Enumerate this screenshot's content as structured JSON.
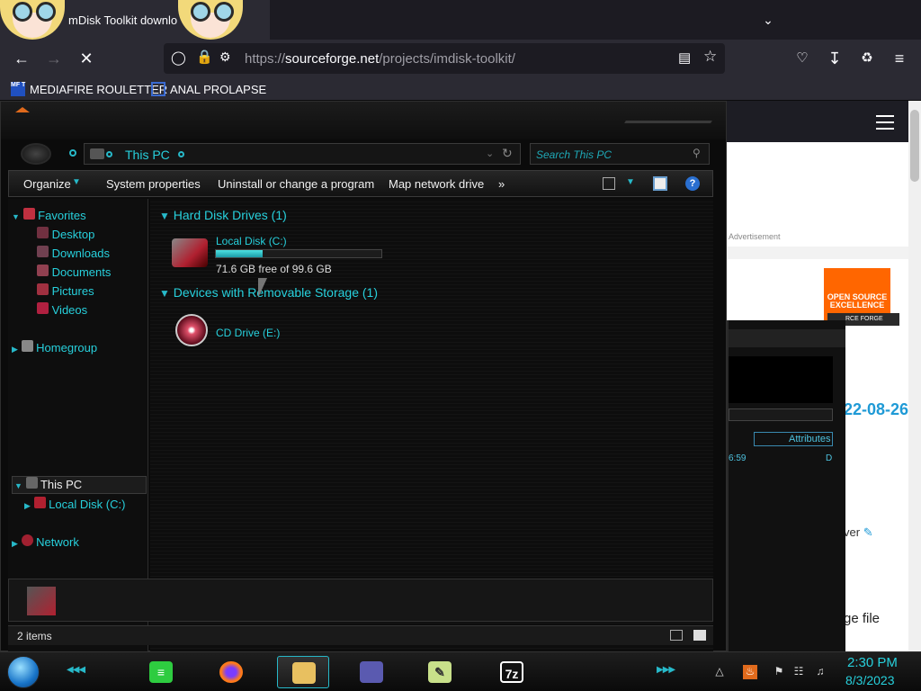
{
  "browser": {
    "tab_title": "mDisk Toolkit downlo",
    "url_prefix": "https://",
    "url_domain": "sourceforge.net",
    "url_path": "/projects/imdisk-toolkit/",
    "bookmarks": [
      {
        "label": "MEDIAFIRE ROULETTER",
        "icon_text": "MF T"
      },
      {
        "label": "ANAL PROLAPSE"
      }
    ]
  },
  "webpage": {
    "advertisement_label": "Advertisement",
    "badge_text": "OPEN SOURCE EXCELLENCE",
    "badge_sub": "RCE FORGE",
    "date_fragment": "22-08-26",
    "ver_fragment": "ver",
    "file_fragment": "ge file"
  },
  "background_window": {
    "attributes_label": "Attributes",
    "time_fragment": "6:59",
    "d_fragment": "D"
  },
  "explorer": {
    "address": "This PC",
    "search_placeholder": "Search This PC",
    "commands": {
      "organize": "Organize",
      "system_properties": "System properties",
      "uninstall": "Uninstall or change a program",
      "map_drive": "Map network drive",
      "more": "»"
    },
    "nav": {
      "favorites": "Favorites",
      "desktop": "Desktop",
      "downloads": "Downloads",
      "documents": "Documents",
      "pictures": "Pictures",
      "videos": "Videos",
      "homegroup": "Homegroup",
      "this_pc": "This PC",
      "local_disk": "Local Disk (C:)",
      "network": "Network"
    },
    "groups": {
      "hard_disk": "Hard Disk Drives (1)",
      "removable": "Devices with Removable Storage (1)"
    },
    "drives": {
      "local_disk_label": "Local Disk (C:)",
      "local_disk_free": "71.6 GB free of 99.6 GB",
      "local_disk_used_fraction": 0.281,
      "cd_label": "CD Drive (E:)"
    },
    "status": "2 items"
  },
  "taskbar": {
    "clock_time": "2:30 PM",
    "clock_date": "8/3/2023",
    "sevenzip_label": "7z"
  },
  "colors": {
    "accent_cyan": "#27d0dc",
    "browser_bg": "#2b2a33",
    "sf_orange": "#ff6600"
  }
}
